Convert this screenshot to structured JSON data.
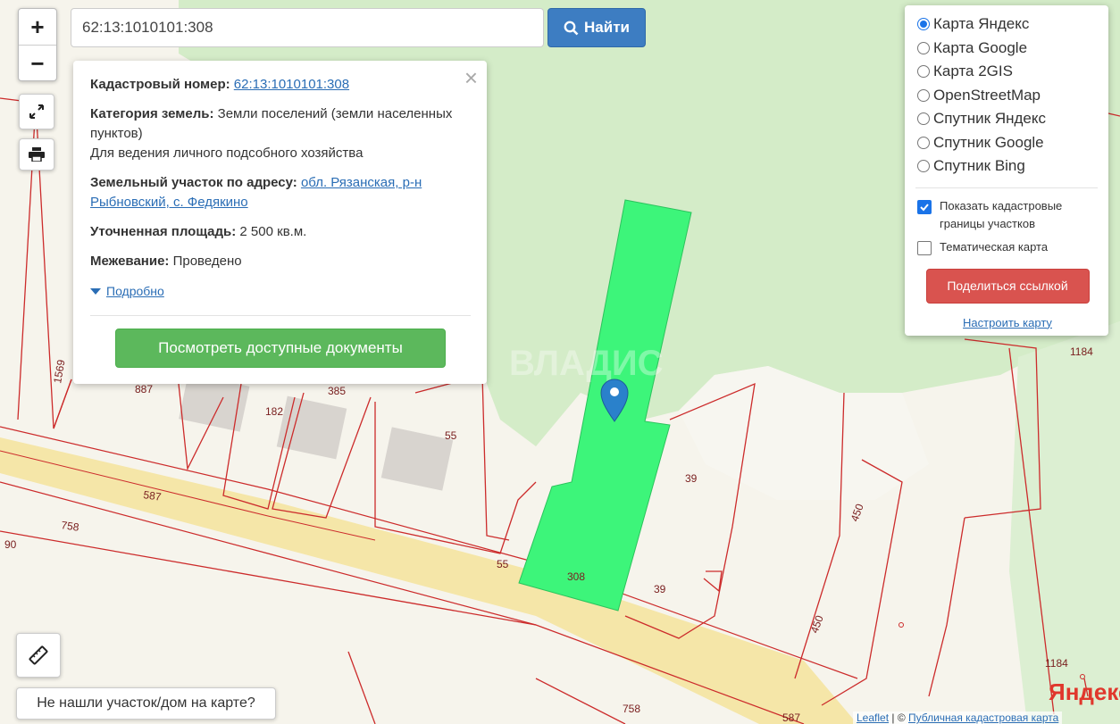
{
  "search": {
    "value": "62:13:1010101:308",
    "button_label": "Найти"
  },
  "controls": {
    "zoom_in": "+",
    "zoom_out": "−",
    "not_found_label": "Не нашли участок/дом на карте?"
  },
  "popup": {
    "cadastral_label": "Кадастровый номер:",
    "cadastral_value": "62:13:1010101:308",
    "category_label": "Категория земель:",
    "category_value": "Земли поселений (земли населенных пунктов)",
    "usage_value": "Для ведения личного подсобного хозяйства",
    "address_label": "Земельный участок по адресу:",
    "address_value": "обл. Рязанская, р-н Рыбновский, с. Федякино",
    "area_label": "Уточненная площадь:",
    "area_value": "2 500 кв.м.",
    "survey_label": "Межевание:",
    "survey_value": "Проведено",
    "details_label": "Подробно",
    "docs_button": "Посмотреть доступные документы",
    "close_symbol": "×"
  },
  "layers": {
    "options": [
      {
        "label": "Карта Яндекс",
        "selected": true
      },
      {
        "label": "Карта Google",
        "selected": false
      },
      {
        "label": "Карта 2GIS",
        "selected": false
      },
      {
        "label": "OpenStreetMap",
        "selected": false
      },
      {
        "label": "Спутник Яндекс",
        "selected": false
      },
      {
        "label": "Спутник Google",
        "selected": false
      },
      {
        "label": "Спутник Bing",
        "selected": false
      }
    ],
    "show_borders_label": "Показать кадастровые границы участков",
    "show_borders_checked": true,
    "thematic_label": "Тематическая карта",
    "thematic_checked": false,
    "share_button": "Поделиться ссылкой",
    "setup_link": "Настроить карту"
  },
  "map": {
    "parcel_labels": [
      "308",
      "39",
      "39",
      "55",
      "55",
      "182",
      "385",
      "887",
      "1569",
      "587",
      "587",
      "758",
      "758",
      "450",
      "450",
      "1184",
      "1184",
      "90"
    ],
    "watermark": "ВЛАДИС",
    "colors": {
      "selected_parcel": "#3df57a",
      "boundary": "#cc2b2b",
      "road": "#f5e6a8",
      "forest": "#d4ecc8",
      "background": "#f6f4ec",
      "primary_button": "#3d7dc2",
      "docs_button": "#5cb85c",
      "share_button": "#d9534f"
    }
  },
  "attribution": {
    "leaflet": "Leaflet",
    "separator": " | © ",
    "source": "Публичная кадастровая карта",
    "yandex_logo": "Яндекс"
  }
}
